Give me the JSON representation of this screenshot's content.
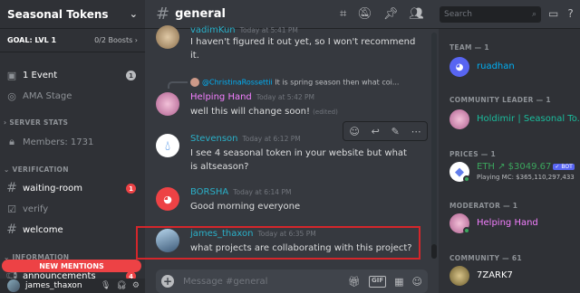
{
  "server": {
    "name": "Seasonal Tokens",
    "goal": "GOAL: LVL 1",
    "boosts": "0/2 Boosts"
  },
  "sidebar": {
    "events": {
      "label": "1 Event",
      "badge": "1"
    },
    "stage": {
      "label": "AMA Stage"
    },
    "cat_stats": "SERVER STATS",
    "members_stat": "Members: 1731",
    "cat_verification": "VERIFICATION",
    "channels": [
      {
        "label": "waiting-room",
        "badge": "1"
      },
      {
        "label": "verify"
      },
      {
        "label": "welcome"
      }
    ],
    "cat_info": "INFORMATION",
    "announcements": {
      "label": "announcements",
      "badge": "4"
    },
    "new_mentions": "NEW MENTIONS"
  },
  "user_panel": {
    "name": "james_thaxon"
  },
  "channel": {
    "name": "general"
  },
  "search": {
    "placeholder": "Search"
  },
  "messages": [
    {
      "author": "vadimKun",
      "time": "Today at 5:41 PM",
      "text": "I haven't figured it out yet, so I won't recommend it.",
      "color": "#2ab0c8"
    },
    {
      "reply_to": "@ChristinaRossettii",
      "reply_text": "It is spring season then what coi...",
      "author": "Helping Hand",
      "time": "Today at 5:42 PM",
      "text": "well this will change soon!",
      "edited": "(edited)",
      "color": "#f47fff"
    },
    {
      "author": "Stevenson",
      "time": "Today at 6:12 PM",
      "text": "I see 4 seasonal token in your website but what is altseason?",
      "color": "#2ab0c8"
    },
    {
      "author": "BORSHA",
      "time": "Today at 6:14 PM",
      "text": "Good morning everyone",
      "color": "#2ab0c8"
    },
    {
      "author": "james_thaxon",
      "time": "Today at 6:35 PM",
      "text": "what projects are collaborating with this project?",
      "color": "#2ab0c8"
    }
  ],
  "composer": {
    "placeholder": "Message #general",
    "gif": "GIF"
  },
  "members_panel": {
    "groups": [
      {
        "title": "TEAM — 1",
        "members": [
          {
            "name": "ruadhan",
            "color": "#00aff4"
          }
        ]
      },
      {
        "title": "COMMUNITY LEADER — 1",
        "members": [
          {
            "name": "Holdimir | Seasonal To...",
            "color": "#1abc9c"
          }
        ]
      },
      {
        "title": "PRICES — 1",
        "members": [
          {
            "name": "ETH ↗ $3049.67",
            "bot": "✓ BOT",
            "sub": "Playing MC: $365,110,297,433",
            "color": "#3ba55d"
          }
        ]
      },
      {
        "title": "MODERATOR — 1",
        "members": [
          {
            "name": "Helping Hand",
            "color": "#f47fff"
          }
        ]
      },
      {
        "title": "COMMUNITY — 61",
        "members": [
          {
            "name": "7ZARK7",
            "color": "#ffffff"
          }
        ]
      }
    ]
  }
}
